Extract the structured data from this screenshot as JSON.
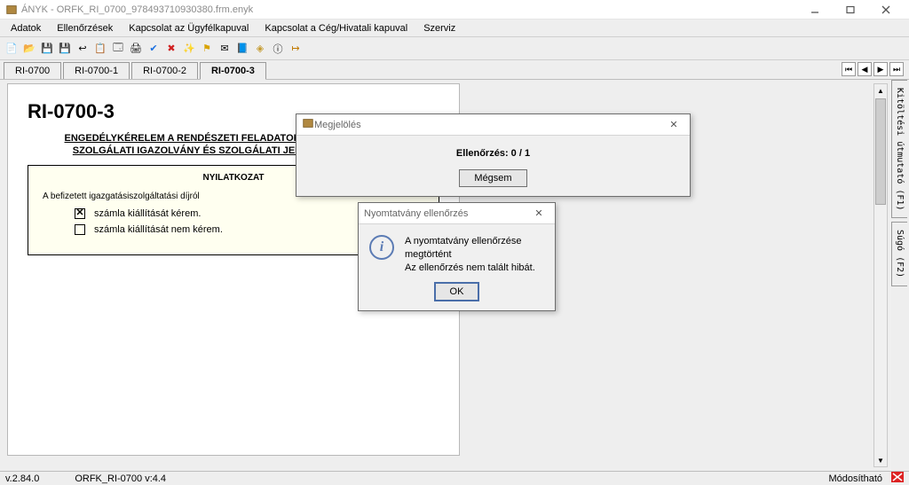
{
  "window": {
    "title": "ÁNYK - ORFK_RI_0700_978493710930380.frm.enyk"
  },
  "menu": {
    "items": [
      "Adatok",
      "Ellenőrzések",
      "Kapcsolat az Ügyfélkapuval",
      "Kapcsolat a Cég/Hivatali kapuval",
      "Szerviz"
    ]
  },
  "tabs": {
    "items": [
      "RI-0700",
      "RI-0700-1",
      "RI-0700-2",
      "RI-0700-3"
    ],
    "active": 3
  },
  "side_tabs": {
    "items": [
      "Kitöltési útmutató (F1)",
      "Súgó (F2)"
    ]
  },
  "form": {
    "title": "RI-0700-3",
    "subtitle_line1": "ENGEDÉLYKÉRELEM A RENDÉSZETI FELADATOKAT ELLÁTÓ SZEMÉLY",
    "subtitle_line2": "SZOLGÁLATI IGAZOLVÁNY ÉS SZOLGÁLATI JELVÉNY KIADÁSÁHOZ",
    "section_header": "NYILATKOZAT",
    "fee_intro": "A befizetett igazgatásiszolgáltatási díjról",
    "option1": {
      "label": "számla kiállítását kérem.",
      "checked": true
    },
    "option2": {
      "label": "számla kiállítását nem kérem.",
      "checked": false
    }
  },
  "dialog_progress": {
    "title": "Megjelölés",
    "status": "Ellenőrzés: 0 / 1",
    "cancel": "Mégsem"
  },
  "dialog_result": {
    "title": "Nyomtatvány ellenőrzés",
    "line1": "A nyomtatvány ellenőrzése megtörtént",
    "line2": "Az ellenőrzés nem talált hibát.",
    "ok": "OK"
  },
  "status": {
    "version": "v.2.84.0",
    "form_version": "ORFK_RI-0700 v:4.4",
    "mode": "Módosítható"
  },
  "icons": {
    "new": "📄",
    "open": "📂",
    "save": "💾",
    "saveas": "💾",
    "undo": "↩",
    "copy": "📋",
    "table": "🗔",
    "print": "🖨",
    "check": "✔",
    "delete": "✖",
    "wand": "✨",
    "flag": "⚑",
    "mail": "✉",
    "book": "📘",
    "stamp": "◈",
    "info": "ⓘ",
    "exit": "↦"
  }
}
